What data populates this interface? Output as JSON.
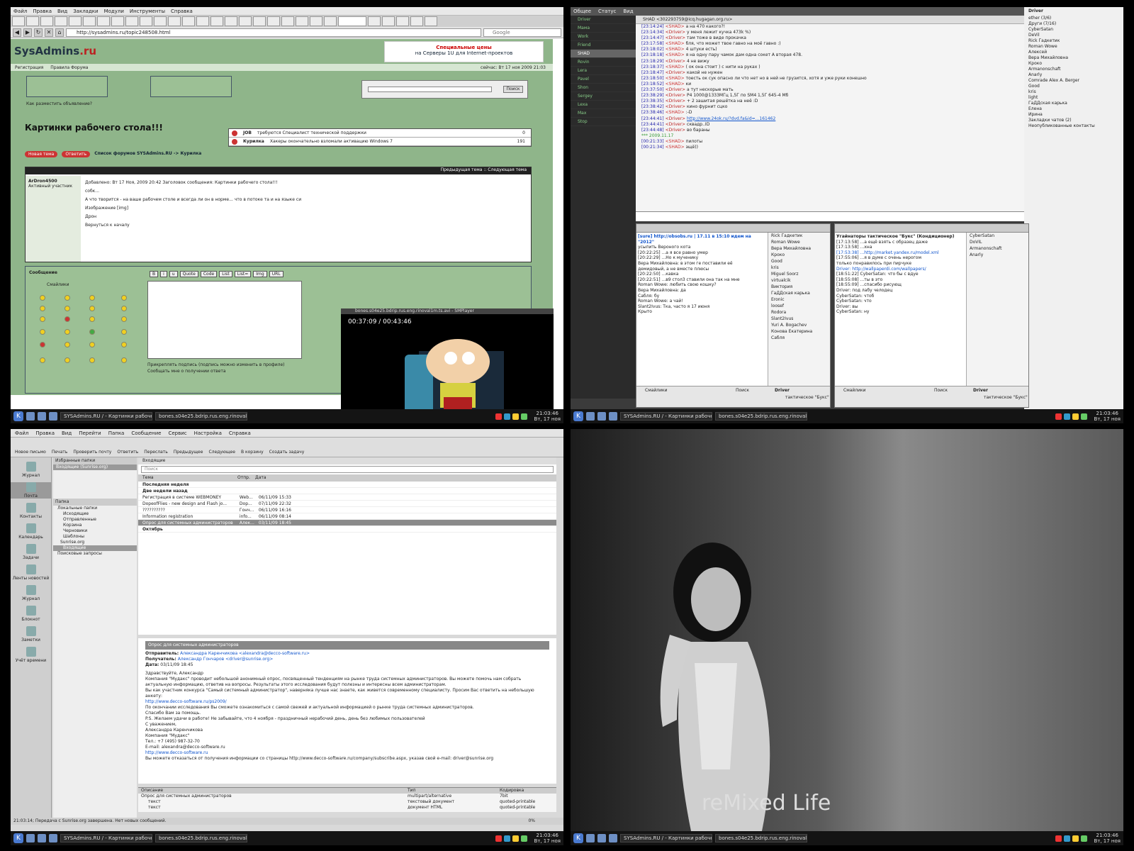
{
  "q1": {
    "menu": [
      "Файл",
      "Правка",
      "Вид",
      "Закладки",
      "Модули",
      "Инструменты",
      "Справка"
    ],
    "url": "http://sysadmins.ru/topic248508.html",
    "search_placeholder": "Google",
    "logo_main": "SysAdmins",
    "logo_tld": ".ru",
    "banner_line1": "Специальные цены",
    "banner_line2": "на Серверы 1U для Internet-проектов",
    "nav_left": "Регистрация",
    "nav_right": "Правила Форума",
    "nav_time": "сейчас: Вт 17 ноя 2009 21:03",
    "search_button": "Поиск",
    "page_title": "Картинки рабочего стола!!!",
    "ad_link": "Как разместить объявление?",
    "forum_rows": [
      {
        "tag": "JOB",
        "text": "требуются Специалист технической поддержки",
        "n": "0"
      },
      {
        "tag": "Курилка",
        "text": "Хакеры окончательно взломали активацию Windows 7",
        "n": "191"
      }
    ],
    "btn_new": "Новая тема",
    "btn_reply": "Ответить",
    "breadcrumb": "Список форумов SYSAdmins.RU -> Курилка",
    "thread_nav": "Предыдущая тема :: Следующая тема",
    "col_author": "Автор",
    "col_message": "Сообщение",
    "author": "ArDron4500",
    "author_rank": "Активный участник",
    "post_header": "Добавлено: Вт 17 Ноя, 2009 20:42   Заголовок сообщения: Картинки рабочего стола!!!",
    "post_l1": "собк...",
    "post_l2": "А что творится - на ваше рабочем столе и всегда ли он в норме... что в потоке та и на языке си",
    "post_l3": "Изображение [img]",
    "post_l4": "Дрон",
    "back_top": "Вернуться к началу",
    "reply_label": "Сообщение",
    "smileys_label": "Смайлики",
    "fmt_buttons": [
      "B",
      "i",
      "u",
      "Quote",
      "Code",
      "List",
      "List=",
      "Img",
      "URL"
    ],
    "opt1": "Прикреплять подпись (подпись можно изменить в профиле)",
    "opt2": "Сообщать мне о получении ответа",
    "player_title": "bones.s04e25.bdrip.rus.eng.rinoval1m.ts.avi - SMPlayer",
    "player_time": "00:37:09 / 00:43:46"
  },
  "q2": {
    "menu": [
      "Общее",
      "Статус",
      "Вид"
    ],
    "chat_title": "SHAD <302293759@icq.hugagan.org.ru>",
    "contacts": [
      "Driver",
      "Мама",
      "Work",
      "Friend",
      "SHAD",
      "Rovin",
      "Lera",
      "Pavel",
      "Shon",
      "Sergey",
      "Lexa",
      "Max",
      "Stop"
    ],
    "log": [
      {
        "t": "[23:14:24]",
        "n": "<SHAD>",
        "m": "а на 470 какого?!"
      },
      {
        "t": "[23:14:34]",
        "n": "<Driver>",
        "m": "у меня лежит кучка 473k %)"
      },
      {
        "t": "[23:14:47]",
        "n": "<Driver>",
        "m": "там тоже в виде прокачка"
      },
      {
        "t": "[23:17:58]",
        "n": "<SHAD>",
        "m": "бля, что может твое гавно на моё гавно :)"
      },
      {
        "t": "[23:18:02]",
        "n": "<SHAD>",
        "m": "4 штуки есть)"
      },
      {
        "t": "[23:18:18]",
        "n": "<SHAD>",
        "m": "я на одну пару чамок дам одна сокет А вторая 478."
      },
      {
        "t": "[23:18:29]",
        "n": "<Driver>",
        "m": "4 не вижу"
      },
      {
        "t": "[23:18:37]",
        "n": "<SHAD>",
        "m": "( ок она стоит ) с нити на руках )"
      },
      {
        "t": "[23:18:47]",
        "n": "<Driver>",
        "m": "какой не нужен"
      },
      {
        "t": "[23:18:50]",
        "n": "<SHAD>",
        "m": "тоесть ок сук опасно ли что нет но в ней не грузится, хотя и уже руки конешно"
      },
      {
        "t": "[23:18:52]",
        "n": "<SHAD>",
        "m": "ки"
      },
      {
        "t": "[23:37:50]",
        "n": "<Driver>",
        "m": "а тут нескорые мать"
      },
      {
        "t": "[23:38:29]",
        "n": "<Driver>",
        "m": "P4 1000@1333МГц 1,5Г по SM4 1,5Г 645-4 Мб"
      },
      {
        "t": "[23:38:35]",
        "n": "<Driver>",
        "m": "+ 2 зашитая решётка на неё :D"
      },
      {
        "t": "[23:38:42]",
        "n": "<Driver>",
        "m": "кино фурнит сцко"
      },
      {
        "t": "[23:38:46]",
        "n": "<SHAD>",
        "m": ":-D"
      },
      {
        "t": "[23:44:41]",
        "n": "<Driver>",
        "m": "http://www.24ok.ru/?dvd.fa&id=...161462"
      },
      {
        "t": "[23:44:41]",
        "n": "<Driver>",
        "m": "сквадр..ID"
      },
      {
        "t": "[23:44:48]",
        "n": "<Driver>",
        "m": "во бараны"
      },
      {
        "t": "",
        "n": "***",
        "m": "2009.11.17"
      },
      {
        "t": "[00:21:33]",
        "n": "<SHAD>",
        "m": "пилоты"
      },
      {
        "t": "[00:21:34]",
        "n": "<SHAD>",
        "m": "эщё))"
      }
    ],
    "roster": [
      "Driver",
      "ether (3/6)",
      "Други (7/16)",
      "CyberSatan",
      "DeVil",
      "Rick Гадкетик",
      "Roman Wowe",
      "Алексей",
      "Вера Михайловна",
      "Кроко",
      "Armanonschaft",
      "Anarly",
      "Comrade Alex A. Berger",
      "Good",
      "kris",
      "light",
      "ГаДДская карька",
      "Елена",
      "Ирина",
      "Закладки чатов (2)",
      "Неопубликованные контакты"
    ],
    "room1_topic": "[sure] http://obsobs.ru | 17.11 в 15:10 идем на \"2012\"",
    "room1_msgs": [
      "усыпить Вероного кота",
      "[20:22:25] ...а я все равно умер",
      "[20:22:29] ...Но к мученику",
      "Вера Михайловна: в этом ге поставили её",
      "демидовый, а не вместе плюсы",
      "[20:22:50] ...кавка",
      "[20:22:51] ...в9 стол3 ставили она так на мне",
      "Roman Wowe: любить свою кошку?",
      "Вера Михайловна: да",
      "Сабля: бу",
      "Roman Wowe: а чай!",
      "Slant2Ivus: Тка, часто я 17 июня",
      "Крыто"
    ],
    "room1_users": [
      "Rick Гадкетик",
      "Roman Wowe",
      "Вера Михайловна",
      "Кроко",
      "Good",
      "kris",
      "Miguel Soorz",
      "virtualcik",
      "Виктория",
      "ГаДДская карька",
      "Eronic",
      "loosef",
      "Rodora",
      "Slant2Ivus",
      "Yuri A. Bogachev",
      "Конова Екатерина",
      "Сабля"
    ],
    "room2_topic": "Угайнаторы тактическое \"Букс\" (Кондиционер)",
    "room2_msgs": [
      "[17:13:58] ...а ещё взять с образец даже",
      "[17:13:58] ...хна",
      "[17:53:38] ...http://market.yandex.ru/model.xml",
      "[17:55:06] ...я в думе с очень нерогом",
      "только понравилось при пирчуке",
      "Driver: http://wallpaperdi.com/wallpapers/",
      "[18:51:22] CyberSatan: что бы с вдуе",
      "[18:55:08] ...ты в это",
      "[18:55:09] ...спасибо рисующ",
      "Driver: под лабу челодец",
      "CyberSatan: чтоб",
      "CyberSatan: что",
      "Driver: вы",
      "CyberSatan: ну"
    ],
    "room2_users": [
      "CyberSatan",
      "DoVIL",
      "Armanonschaft",
      "Anarly"
    ],
    "room_footer_user": "Driver",
    "room_footer_status": "тактическое \"Букс\"",
    "search_btn": "Поиск",
    "smileys_btn": "Смайлики"
  },
  "q3": {
    "window_title": "Почта - Kontact",
    "menu": [
      "Файл",
      "Правка",
      "Вид",
      "Перейти",
      "Папка",
      "Сообщение",
      "Сервис",
      "Настройка",
      "Справка"
    ],
    "toolbar": [
      "Новое письмо",
      "Печать",
      "Проверить почту",
      "Ответить",
      "Переслать",
      "Предыдущее",
      "Следующее",
      "В корзину",
      "Создать задачу"
    ],
    "sidebar": [
      "Журнал",
      "Почта",
      "Контакты",
      "Календарь",
      "Задачи",
      "Ленты новостей",
      "Журнал",
      "Блокнот",
      "Заметки",
      "Учёт времени"
    ],
    "fav_folders": "Избранные папки",
    "fav_item": "Входящие (Sunrise.org)",
    "folders_header": "Папка",
    "folders": [
      "Локальные папки",
      "Исходящие",
      "Отправленные",
      "Корзина",
      "Черновики",
      "Шаблоны",
      "Sunrise.org",
      "Входящие",
      "Поисковые запросы"
    ],
    "tab_inbox": "Входящие",
    "search_placeholder": "Поиск",
    "cols": [
      "Тема",
      "Отпр.",
      "Дата"
    ],
    "groups": [
      "Последняя неделя",
      "Две недели назад",
      "Октябрь"
    ],
    "rows": [
      {
        "s": "Регистрация в системе WEBMONEY",
        "f": "Web...",
        "d": "06/11/09 15:33"
      },
      {
        "s": "DopeofFlies - new design and Flash jo...",
        "f": "Dop...",
        "d": "07/11/09 22:32"
      },
      {
        "s": "??????????",
        "f": "Гонч...",
        "d": "06/11/09 16:16"
      },
      {
        "s": "Information registration",
        "f": "info...",
        "d": "06/11/09 08:14"
      },
      {
        "s": "Опрос для системных администраторов",
        "f": "Алек...",
        "d": "03/11/09 18:45"
      }
    ],
    "msg_subject": "Опрос для системных администраторов",
    "msg_from_label": "Отправитель:",
    "msg_from": "Александра Каренчикова <alexandra@decco-software.ru>",
    "msg_to_label": "Получатель:",
    "msg_to": "Александр Гончаров <driver@sunrise.org>",
    "msg_date_label": "Дата:",
    "msg_date": "03/11/09 18:45",
    "body": [
      "Здравствуйте, Александр",
      "Компания \"Мудакс\" проводит небольшой анонимный опрос, посвященный тенденциям на рынке труда системных администраторов. Вы можете помочь нам собрать",
      "актуальную информацию, ответив на вопросы. Результаты этого исследования будут полезны и интересны всем администраторам.",
      "Вы как участник конкурса \"Самый системный администратор\", наверняка лучше нас знаете, как живется современному специалисту. Просим Вас ответить на небольшую анкету:",
      "http://www.decco-software.ru/ps2009/",
      "По окончании исследования Вы сможете ознакомиться с самой свежей и актуальной информацией о рынке труда системных администраторов.",
      "Спасибо Вам за помощь.",
      "P.S. Желаем удачи в работе! Не забывайте, что 4 ноября - праздничный нерабочий день, день без любимых пользователей",
      "С уважением,",
      "Александра Каренчикова",
      "Компания \"Мудакс\"",
      "Тел.: +7 (495) 987-32-70",
      "E-mail: alexandra@decco-software.ru",
      "http://www.decco-software.ru",
      "Вы можете отказаться от получения информации со страницы http://www.decco-software.ru/company/subscribe.aspx, указав свой e-mail: driver@sunrise.org"
    ],
    "attach_cols": [
      "Описание",
      "Тип",
      "Кодировка"
    ],
    "attach_rows": [
      {
        "n": "Опрос для системных администраторов",
        "t": "multipart/alternative",
        "e": "7bit"
      },
      {
        "n": "текст",
        "t": "текстовый документ",
        "e": "quoted-printable"
      },
      {
        "n": "текст",
        "t": "документ HTML",
        "e": "quoted-printable"
      }
    ],
    "status": "21:03:14; Передача с Sunrise.org завершена. Нет новых сообщений.",
    "progress": "0%"
  },
  "q4": {
    "wallpaper_text": "reMixed Life"
  },
  "taskbar": {
    "task1": "SYSAdmins.RU / - Картинки рабочего...",
    "task2": "bones.s04e25.bdrip.rus.eng.rinoval1...",
    "time": "21:03:46",
    "date": "Вт, 17 ноя"
  }
}
